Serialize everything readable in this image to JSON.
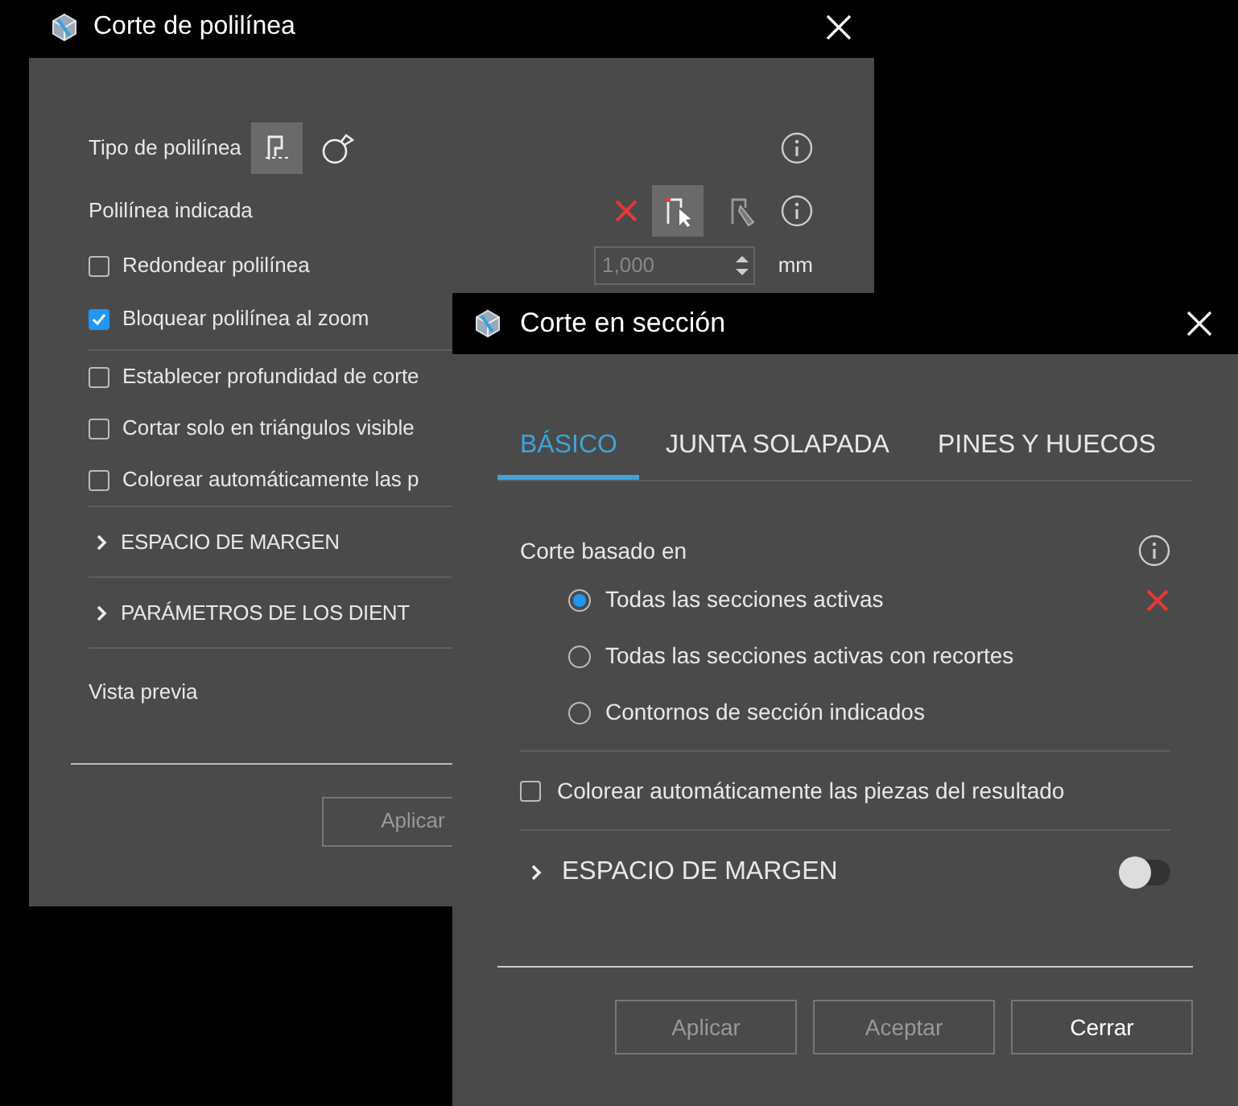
{
  "polyline_cut_window": {
    "title": "Corte de polilínea",
    "polyline_type": {
      "label": "Tipo de polilínea",
      "options": [
        {
          "selected": true
        },
        {
          "selected": false
        }
      ]
    },
    "indicated_polyline": {
      "label": "Polilínea indicada",
      "tools": [
        {
          "selected": true
        },
        {
          "selected": false
        }
      ]
    },
    "rounding": {
      "label": "Redondear polilínea",
      "checked": false,
      "value": "1,000",
      "unit": "mm",
      "disabled": true
    },
    "lock_zoom": {
      "label": "Bloquear polilínea al zoom",
      "checked": true
    },
    "options": [
      {
        "label": "Establecer profundidad de corte",
        "checked": false
      },
      {
        "label": "Cortar solo en triángulos visible",
        "checked": false
      },
      {
        "label": "Colorear automáticamente las p",
        "checked": false
      }
    ],
    "sections": [
      {
        "label": "ESPACIO DE MARGEN",
        "expanded": false
      },
      {
        "label": "PARÁMETROS DE LOS DIENT",
        "expanded": false
      }
    ],
    "preview": {
      "label": "Vista previa"
    },
    "buttons": [
      {
        "label": "Aplicar",
        "disabled": true
      }
    ]
  },
  "section_cut_window": {
    "title": "Corte en sección",
    "tabs": [
      {
        "label": "BÁSICO",
        "selected": true
      },
      {
        "label": "JUNTA SOLAPADA",
        "selected": false
      },
      {
        "label": "PINES Y HUECOS",
        "selected": false
      }
    ],
    "cut_based_on": {
      "label": "Corte basado en",
      "options": [
        {
          "label": "Todas las secciones activas",
          "selected": true
        },
        {
          "label": "Todas las secciones activas con recortes",
          "selected": false
        },
        {
          "label": "Contornos de sección indicados",
          "selected": false
        }
      ]
    },
    "auto_color": {
      "label": "Colorear automáticamente las piezas del resultado",
      "checked": false
    },
    "margin": {
      "label": "ESPACIO DE MARGEN",
      "expanded": false,
      "on": false
    },
    "buttons": [
      {
        "label": "Aplicar",
        "disabled": true
      },
      {
        "label": "Aceptar",
        "disabled": true
      },
      {
        "label": "Cerrar",
        "disabled": false
      }
    ]
  }
}
